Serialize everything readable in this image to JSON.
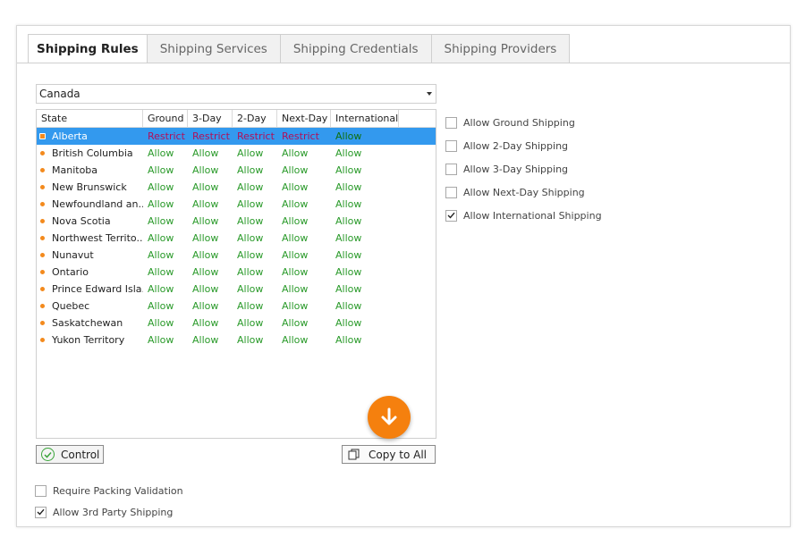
{
  "tabs": [
    "Shipping Rules",
    "Shipping Services",
    "Shipping Credentials",
    "Shipping Providers"
  ],
  "country": "Canada",
  "columns": [
    "State",
    "Ground",
    "3-Day",
    "2-Day",
    "Next-Day",
    "International"
  ],
  "rows": [
    {
      "state": "Alberta",
      "ground": "Restrict",
      "three_day": "Restrict",
      "two_day": "Restrict",
      "next_day": "Restrict",
      "international": "Allow"
    },
    {
      "state": "British Columbia",
      "ground": "Allow",
      "three_day": "Allow",
      "two_day": "Allow",
      "next_day": "Allow",
      "international": "Allow"
    },
    {
      "state": "Manitoba",
      "ground": "Allow",
      "three_day": "Allow",
      "two_day": "Allow",
      "next_day": "Allow",
      "international": "Allow"
    },
    {
      "state": "New Brunswick",
      "ground": "Allow",
      "three_day": "Allow",
      "two_day": "Allow",
      "next_day": "Allow",
      "international": "Allow"
    },
    {
      "state": "Newfoundland an...",
      "ground": "Allow",
      "three_day": "Allow",
      "two_day": "Allow",
      "next_day": "Allow",
      "international": "Allow"
    },
    {
      "state": "Nova Scotia",
      "ground": "Allow",
      "three_day": "Allow",
      "two_day": "Allow",
      "next_day": "Allow",
      "international": "Allow"
    },
    {
      "state": "Northwest Territo...",
      "ground": "Allow",
      "three_day": "Allow",
      "two_day": "Allow",
      "next_day": "Allow",
      "international": "Allow"
    },
    {
      "state": "Nunavut",
      "ground": "Allow",
      "three_day": "Allow",
      "two_day": "Allow",
      "next_day": "Allow",
      "international": "Allow"
    },
    {
      "state": "Ontario",
      "ground": "Allow",
      "three_day": "Allow",
      "two_day": "Allow",
      "next_day": "Allow",
      "international": "Allow"
    },
    {
      "state": "Prince Edward Isla...",
      "ground": "Allow",
      "three_day": "Allow",
      "two_day": "Allow",
      "next_day": "Allow",
      "international": "Allow"
    },
    {
      "state": "Quebec",
      "ground": "Allow",
      "three_day": "Allow",
      "two_day": "Allow",
      "next_day": "Allow",
      "international": "Allow"
    },
    {
      "state": "Saskatchewan",
      "ground": "Allow",
      "three_day": "Allow",
      "two_day": "Allow",
      "next_day": "Allow",
      "international": "Allow"
    },
    {
      "state": "Yukon Territory",
      "ground": "Allow",
      "three_day": "Allow",
      "two_day": "Allow",
      "next_day": "Allow",
      "international": "Allow"
    }
  ],
  "options": [
    {
      "label": "Allow Ground Shipping",
      "checked": false
    },
    {
      "label": "Allow 2-Day Shipping",
      "checked": false
    },
    {
      "label": "Allow 3-Day Shipping",
      "checked": false
    },
    {
      "label": "Allow Next-Day Shipping",
      "checked": false
    },
    {
      "label": "Allow International Shipping",
      "checked": true
    }
  ],
  "buttons": {
    "control": "Control",
    "copy_all": "Copy to All"
  },
  "bottom_options": [
    {
      "label": "Require Packing Validation",
      "checked": false
    },
    {
      "label": "Allow 3rd Party Shipping",
      "checked": true
    }
  ],
  "colors": {
    "accent": "#f5800e",
    "selected_row": "#3399ee",
    "allow": "#2a9a2a",
    "restrict": "#c0196b"
  }
}
